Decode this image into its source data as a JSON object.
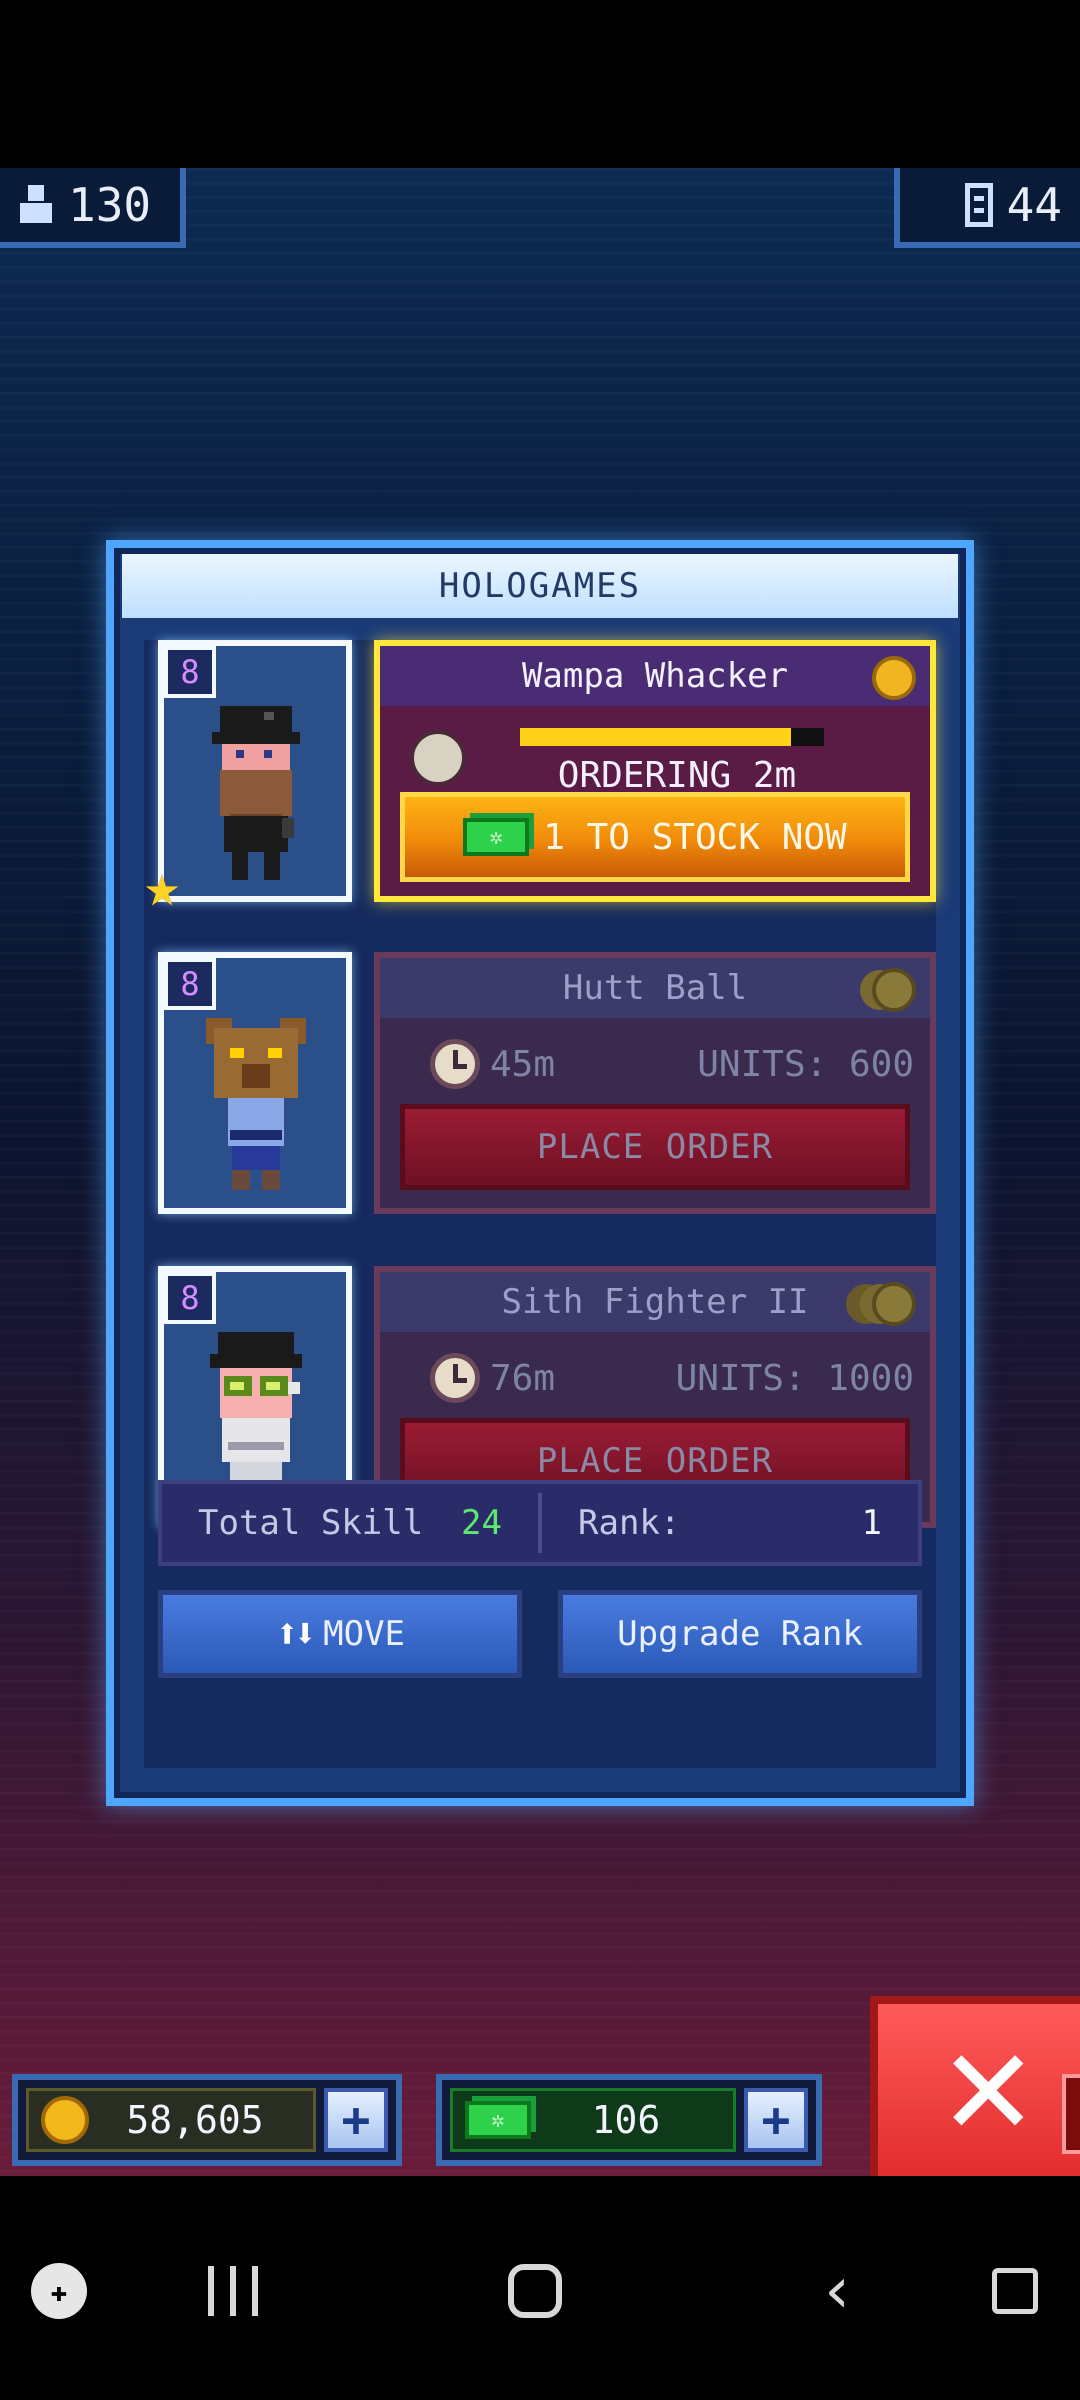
{
  "top_bar": {
    "population": "130",
    "floors": "44"
  },
  "panel": {
    "title": "HOLOGAMES"
  },
  "rows": [
    {
      "level": "8",
      "product": "Wampa Whacker",
      "status": "ORDERING 2m",
      "progress": 0.89,
      "action_label": "1 TO STOCK NOW",
      "icons": [
        "bearded-bitizen",
        "star-icon",
        "coin-icon",
        "cash-icon",
        "customer-icon"
      ]
    },
    {
      "level": "8",
      "product": "Hutt Ball",
      "time": "45m",
      "units": "UNITS: 600",
      "action_label": "PLACE ORDER"
    },
    {
      "level": "8",
      "product": "Sith Fighter II",
      "time": "76m",
      "units": "UNITS: 1000",
      "action_label": "PLACE ORDER"
    }
  ],
  "stats": {
    "skill_label": "Total Skill",
    "skill_value": "24",
    "rank_label": "Rank:",
    "rank_value": "1"
  },
  "buttons": {
    "move": "MOVE",
    "upgrade": "Upgrade Rank"
  },
  "currency": {
    "coins": "58,605",
    "bux": "106"
  },
  "colors": {
    "accent_blue": "#4fa6ff",
    "active_gold": "#ffe83a",
    "order_red": "#9a1c34",
    "skill_green": "#5ee86e"
  }
}
